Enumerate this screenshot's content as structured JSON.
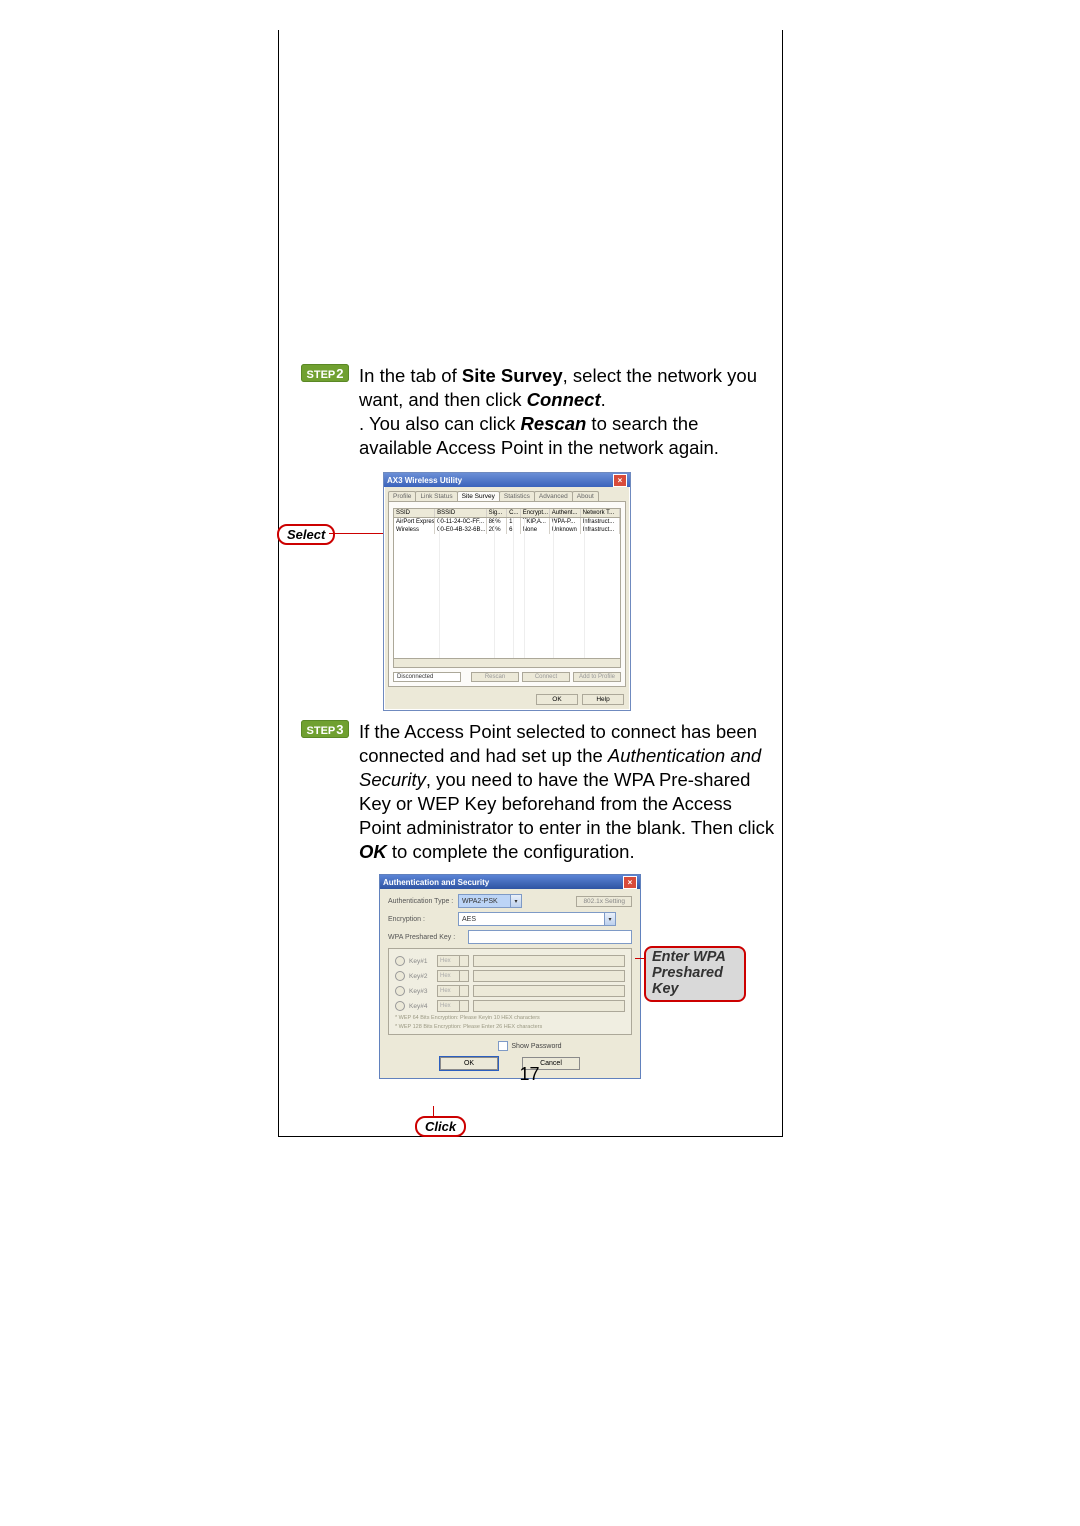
{
  "page_number": "17",
  "step2": {
    "badge": "STEP 2",
    "text_pre": "In the tab of ",
    "bold1": "Site Survey",
    "text_mid1": ", select the network you want, and then click ",
    "bolditalic1": "Connect",
    "text_mid2": ". You also can click ",
    "bolditalic2": "Rescan",
    "text_end": " to search the available Access Point in the network again."
  },
  "select_label": "Select",
  "ssw": {
    "title": "AX3 Wireless Utility",
    "tabs": [
      "Profile",
      "Link Status",
      "Site Survey",
      "Statistics",
      "Advanced",
      "About"
    ],
    "active_tab": "Site Survey",
    "columns": [
      "SSID",
      "BSSID",
      "Sig...",
      "C...",
      "Encrypt...",
      "Authent...",
      "Network T..."
    ],
    "rows": [
      {
        "ssid": "AirPort Express",
        "bssid": "00-11-24-0C-FF...",
        "sig": "86%",
        "c": "1",
        "enc": "TKIP,A...",
        "auth": "WPA-P...",
        "net": "Infrastruct..."
      },
      {
        "ssid": "Wireless",
        "bssid": "00-E0-4B-32-6B...",
        "sig": "20%",
        "c": "6",
        "enc": "None",
        "auth": "Unknown",
        "net": "Infrastruct..."
      }
    ],
    "status": "Disconnected",
    "buttons": {
      "rescan": "Rescan",
      "connect": "Connect",
      "addprofile": "Add to Profile"
    },
    "ok": "OK",
    "help": "Help"
  },
  "step3": {
    "badge": "STEP 3",
    "t1": "If the Access Point selected to connect has been connected and had set up the ",
    "i1": "Authentication and Security",
    "t2": ", you need to have the WPA Pre-shared Key or WEP Key beforehand from the Access Point administrator to enter in the blank. Then click ",
    "b1": "OK",
    "t3": " to complete the configuration."
  },
  "aw": {
    "title": "Authentication and Security",
    "auth_label": "Authentication Type :",
    "auth_val": "WPA2-PSK",
    "setting_btn": "802.1x Setting",
    "enc_label": "Encryption :",
    "enc_val": "AES",
    "psk_label": "WPA Preshared Key :",
    "keys": [
      {
        "r": "Key#1",
        "fmt": "Hex"
      },
      {
        "r": "Key#2",
        "fmt": "Hex"
      },
      {
        "r": "Key#3",
        "fmt": "Hex"
      },
      {
        "r": "Key#4",
        "fmt": "Hex"
      }
    ],
    "help1": "* WEP 64 Bits Encryption:   Please Keyin 10 HEX characters",
    "help2": "* WEP 128 Bits Encryption:   Please Enter 26 HEX characters",
    "show_pw": "Show Password",
    "ok": "OK",
    "cancel": "Cancel"
  },
  "enter_label": "Enter WPA Preshared Key",
  "click_label": "Click"
}
